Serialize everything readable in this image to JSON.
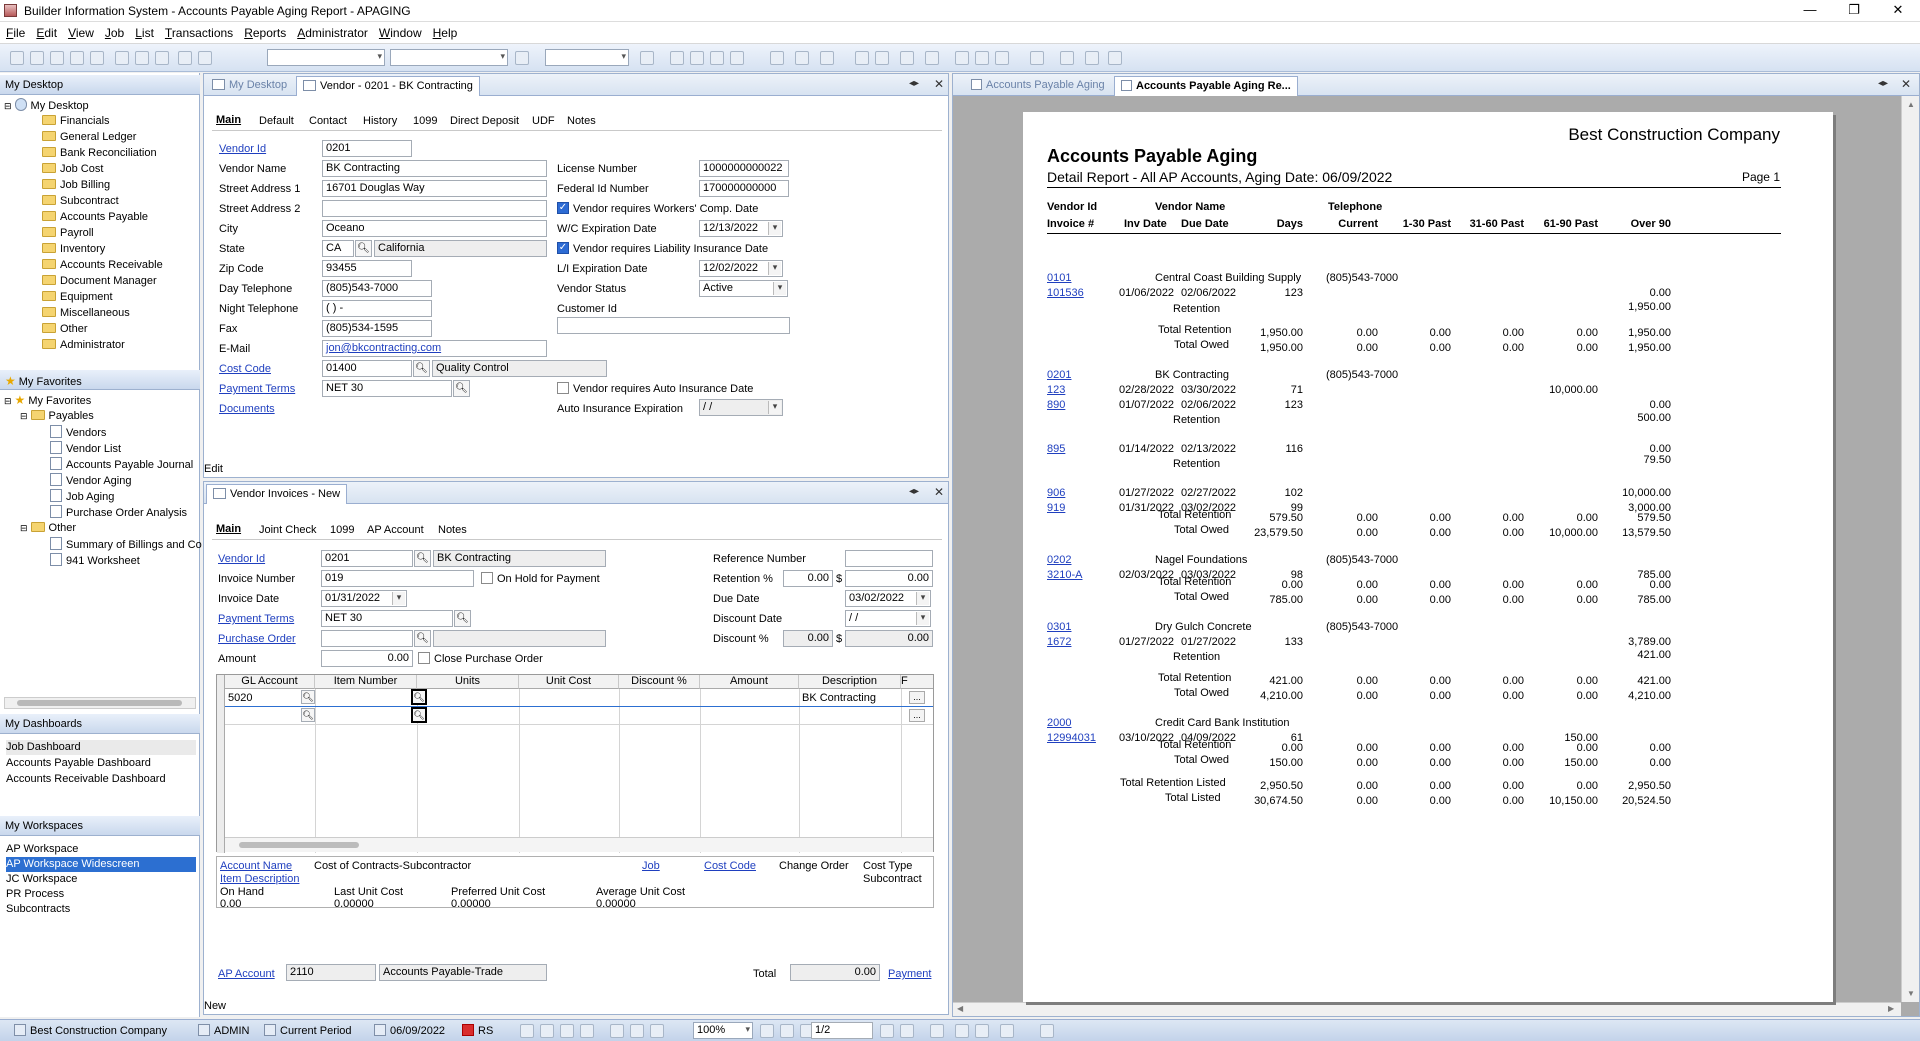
{
  "window": {
    "title": "Builder Information System - Accounts Payable Aging Report - APAGING"
  },
  "menu": [
    "File",
    "Edit",
    "View",
    "Job",
    "List",
    "Transactions",
    "Reports",
    "Administrator",
    "Window",
    "Help"
  ],
  "left": {
    "desktop_header": "My Desktop",
    "desktop_tree": [
      "My Desktop",
      "Financials",
      "General Ledger",
      "Bank Reconciliation",
      "Job Cost",
      "Job Billing",
      "Subcontract",
      "Accounts Payable",
      "Payroll",
      "Inventory",
      "Accounts Receivable",
      "Document Manager",
      "Equipment",
      "Miscellaneous",
      "Other",
      "Administrator"
    ],
    "favorites_header": "My Favorites",
    "fav_root": "My Favorites",
    "fav_payables": "Payables",
    "fav_payables_items": [
      "Vendors",
      "Vendor List",
      "Accounts Payable Journal",
      "Vendor Aging",
      "Job Aging",
      "Purchase Order Analysis"
    ],
    "fav_other": "Other",
    "fav_other_items": [
      "Summary of Billings and Co",
      "941 Worksheet"
    ],
    "dashboards_header": "My Dashboards",
    "dashboards": [
      "Job Dashboard",
      "Accounts Payable Dashboard",
      "Accounts Receivable Dashboard"
    ],
    "workspaces_header": "My Workspaces",
    "workspaces": [
      "AP Workspace",
      "AP Workspace Widescreen",
      "JC Workspace",
      "PR Process",
      "Subcontracts"
    ]
  },
  "vendor": {
    "tab_desktop": "My Desktop",
    "tab_vendor": "Vendor - 0201 - BK Contracting",
    "subtabs": [
      "Main",
      "Default",
      "Contact",
      "History",
      "1099",
      "Direct Deposit",
      "UDF",
      "Notes"
    ],
    "labels": {
      "vendor_id": "Vendor Id",
      "vendor_name": "Vendor Name",
      "street1": "Street Address 1",
      "street2": "Street Address 2",
      "city": "City",
      "state": "State",
      "zip": "Zip Code",
      "day_tel": "Day Telephone",
      "night_tel": "Night Telephone",
      "fax": "Fax",
      "email": "E-Mail",
      "cost_code": "Cost Code",
      "payment_terms": "Payment Terms",
      "documents": "Documents",
      "license": "License Number",
      "federal_id": "Federal Id Number",
      "wc_req": "Vendor requires Workers' Comp. Date",
      "wc_exp": "W/C Expiration Date",
      "li_req": "Vendor requires Liability Insurance Date",
      "li_exp": "L/I Expiration Date",
      "status": "Vendor Status",
      "customer_id": "Customer Id",
      "auto_req": "Vendor requires Auto Insurance Date",
      "auto_exp": "Auto Insurance Expiration"
    },
    "values": {
      "vendor_id": "0201",
      "vendor_name": "BK Contracting",
      "street1": "16701 Douglas Way",
      "street2": "",
      "city": "Oceano",
      "state": "CA",
      "state_name": "California",
      "zip": "93455",
      "day_tel": "(805)543-7000",
      "night_tel": "(  )  -",
      "fax": "(805)534-1595",
      "email": "jon@bkcontracting.com",
      "cost_code": "01400",
      "cost_code_desc": "Quality Control",
      "payment_terms": "NET 30",
      "license": "1000000000022",
      "federal_id": "170000000000",
      "wc_exp": "12/13/2022",
      "li_exp": "12/02/2022",
      "status": "Active",
      "customer_id": "",
      "auto_exp": " / /"
    },
    "status_text": "Edit"
  },
  "invoice": {
    "tab": "Vendor Invoices - New",
    "subtabs": [
      "Main",
      "Joint Check",
      "1099",
      "AP Account",
      "Notes"
    ],
    "labels": {
      "vendor_id": "Vendor Id",
      "invoice_no": "Invoice Number",
      "invoice_date": "Invoice Date",
      "payment_terms": "Payment Terms",
      "purchase_order": "Purchase Order",
      "amount": "Amount",
      "on_hold": "On Hold for Payment",
      "close_po": "Close Purchase Order",
      "reference": "Reference Number",
      "retention": "Retention %",
      "due_date": "Due Date",
      "discount_date": "Discount Date",
      "discount_pct": "Discount %",
      "dollar": "$"
    },
    "values": {
      "vendor_id": "0201",
      "vendor_name": "BK Contracting",
      "invoice_no": "019",
      "invoice_date": "01/31/2022",
      "payment_terms": "NET 30",
      "purchase_order": "",
      "amount": "0.00",
      "reference": "",
      "retention_pct": "0.00",
      "retention_amt": "0.00",
      "due_date": "03/02/2022",
      "discount_date": " / /",
      "discount_pct": "0.00",
      "discount_amt": "0.00"
    },
    "grid_headers": [
      "GL Account",
      "Item Number",
      "Units",
      "Unit Cost",
      "Discount %",
      "Amount",
      "Description",
      "F"
    ],
    "grid_row": {
      "gl_account": "5020",
      "description": "BK Contracting"
    },
    "footer": {
      "account_name": "Account Name",
      "item_description": "Item Description",
      "cost_of_contracts": "Cost of Contracts-Subcontractor",
      "job": "Job",
      "cost_code": "Cost Code",
      "change_order": "Change Order",
      "cost_type": "Cost Type",
      "cost_type_value": "Subcontract",
      "on_hand": "On Hand",
      "on_hand_value": "0.00",
      "last_unit_cost": "Last Unit Cost",
      "last_unit_cost_value": "0.00000",
      "preferred_unit_cost": "Preferred Unit Cost",
      "preferred_unit_cost_value": "0.00000",
      "average_unit_cost": "Average Unit Cost",
      "average_unit_cost_value": "0.00000",
      "ap_account": "AP Account",
      "ap_account_value": "2110",
      "ap_account_name": "Accounts Payable-Trade",
      "total": "Total",
      "total_value": "0.00",
      "payment": "Payment"
    },
    "status_text": "New"
  },
  "report": {
    "tab_aging": "Accounts Payable Aging",
    "tab_report": "Accounts Payable Aging Re...",
    "company": "Best Construction Company",
    "title": "Accounts Payable Aging",
    "subtitle": "Detail Report - All AP Accounts,  Aging Date: 06/09/2022",
    "page": "Page  1",
    "headers": {
      "vendor_id": "Vendor Id",
      "vendor_name": "Vendor Name",
      "telephone": "Telephone",
      "invoice": "Invoice #",
      "inv_date": "Inv Date",
      "due_date": "Due Date",
      "days": "Days",
      "current": "Current",
      "d1_30": "1-30 Past",
      "d31_60": "31-60 Past",
      "d61_90": "61-90 Past",
      "over90": "Over 90"
    },
    "vendors": [
      {
        "id": "0101",
        "name": "Central Coast Building Supply",
        "tel": "(805)543-7000"
      },
      {
        "id": "0201",
        "name": "BK Contracting",
        "tel": "(805)543-7000"
      },
      {
        "id": "0202",
        "name": "Nagel Foundations",
        "tel": "(805)543-7000"
      },
      {
        "id": "0301",
        "name": "Dry Gulch Concrete",
        "tel": "(805)543-7000"
      },
      {
        "id": "2000",
        "name": "Credit Card Bank Institution",
        "tel": ""
      }
    ],
    "invoices": [
      {
        "inv": "101536",
        "inv_date": "01/06/2022",
        "due": "02/06/2022",
        "days": "123",
        "current": "",
        "d30": "",
        "d60": "",
        "d90": "",
        "over": "0.00"
      },
      {
        "inv": "123",
        "inv_date": "02/28/2022",
        "due": "03/30/2022",
        "days": "71",
        "current": "",
        "d30": "",
        "d60": "",
        "d90": "10,000.00",
        "over": ""
      },
      {
        "inv": "890",
        "inv_date": "01/07/2022",
        "due": "02/06/2022",
        "days": "123",
        "current": "",
        "d30": "",
        "d60": "",
        "d90": "",
        "over": "0.00"
      },
      {
        "inv": "895",
        "inv_date": "01/14/2022",
        "due": "02/13/2022",
        "days": "116",
        "current": "",
        "d30": "",
        "d60": "",
        "d90": "",
        "over": "0.00"
      },
      {
        "inv": "906",
        "inv_date": "01/27/2022",
        "due": "02/27/2022",
        "days": "102",
        "current": "",
        "d30": "",
        "d60": "",
        "d90": "",
        "over": "10,000.00"
      },
      {
        "inv": "919",
        "inv_date": "01/31/2022",
        "due": "03/02/2022",
        "days": "99",
        "current": "",
        "d30": "",
        "d60": "",
        "d90": "",
        "over": "3,000.00"
      },
      {
        "inv": "3210-A",
        "inv_date": "02/03/2022",
        "due": "03/03/2022",
        "days": "98",
        "current": "",
        "d30": "",
        "d60": "",
        "d90": "",
        "over": "785.00"
      },
      {
        "inv": "1672",
        "inv_date": "01/27/2022",
        "due": "01/27/2022",
        "days": "133",
        "current": "",
        "d30": "",
        "d60": "",
        "d90": "",
        "over": "3,789.00"
      },
      {
        "inv": "12994031",
        "inv_date": "03/10/2022",
        "due": "04/09/2022",
        "days": "61",
        "current": "",
        "d30": "",
        "d60": "",
        "d90": "150.00",
        "over": ""
      }
    ],
    "retention_label": "Retention",
    "retention_values": [
      "1,950.00",
      "500.00",
      "79.50",
      "421.00"
    ],
    "total_retention_label": "Total Retention",
    "total_owed_label": "Total Owed",
    "totals": [
      {
        "ret": [
          "1,950.00",
          "0.00",
          "0.00",
          "0.00",
          "0.00",
          "1,950.00"
        ],
        "owed": [
          "1,950.00",
          "0.00",
          "0.00",
          "0.00",
          "0.00",
          "1,950.00"
        ]
      },
      {
        "ret": [
          "579.50",
          "0.00",
          "0.00",
          "0.00",
          "0.00",
          "579.50"
        ],
        "owed": [
          "23,579.50",
          "0.00",
          "0.00",
          "0.00",
          "10,000.00",
          "13,579.50"
        ]
      },
      {
        "ret": [
          "0.00",
          "0.00",
          "0.00",
          "0.00",
          "0.00",
          "0.00"
        ],
        "owed": [
          "785.00",
          "0.00",
          "0.00",
          "0.00",
          "0.00",
          "785.00"
        ]
      },
      {
        "ret": [
          "421.00",
          "0.00",
          "0.00",
          "0.00",
          "0.00",
          "421.00"
        ],
        "owed": [
          "4,210.00",
          "0.00",
          "0.00",
          "0.00",
          "0.00",
          "4,210.00"
        ]
      },
      {
        "ret": [
          "0.00",
          "0.00",
          "0.00",
          "0.00",
          "0.00",
          "0.00"
        ],
        "owed": [
          "150.00",
          "0.00",
          "0.00",
          "0.00",
          "150.00",
          "0.00"
        ]
      }
    ],
    "grand": {
      "ret_label": "Total Retention Listed",
      "total_label": "Total Listed",
      "ret": [
        "2,950.50",
        "0.00",
        "0.00",
        "0.00",
        "0.00",
        "2,950.50"
      ],
      "total": [
        "30,674.50",
        "0.00",
        "0.00",
        "0.00",
        "10,150.00",
        "20,524.50"
      ]
    }
  },
  "status": {
    "company": "Best Construction Company",
    "user": "ADMIN",
    "period": "Current Period",
    "date": "06/09/2022",
    "rs": "RS",
    "zoom": "100%",
    "page": "1/2"
  }
}
